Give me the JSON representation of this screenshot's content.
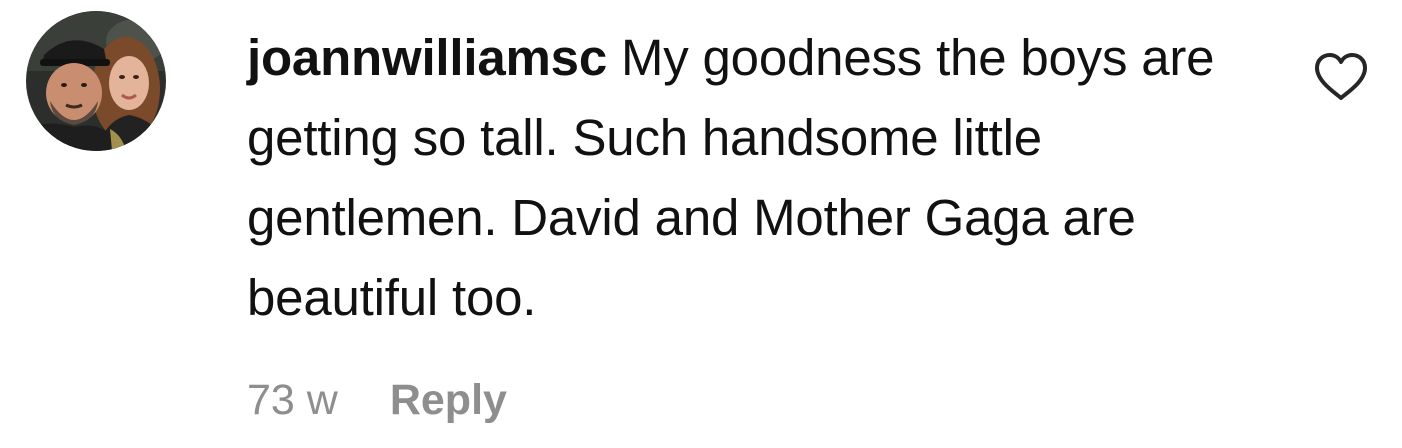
{
  "comment": {
    "username": "joannwilliamsc",
    "text": "My goodness the boys are getting so tall. Such handsome little gentlemen. David and Mother Gaga are beautiful too.",
    "timestamp": "73 w",
    "reply_label": "Reply",
    "avatar_icon": "profile-photo",
    "like_icon": "heart-outline-icon",
    "liked": false
  },
  "colors": {
    "text": "#111111",
    "muted": "#8e8e8e",
    "background": "#ffffff"
  }
}
